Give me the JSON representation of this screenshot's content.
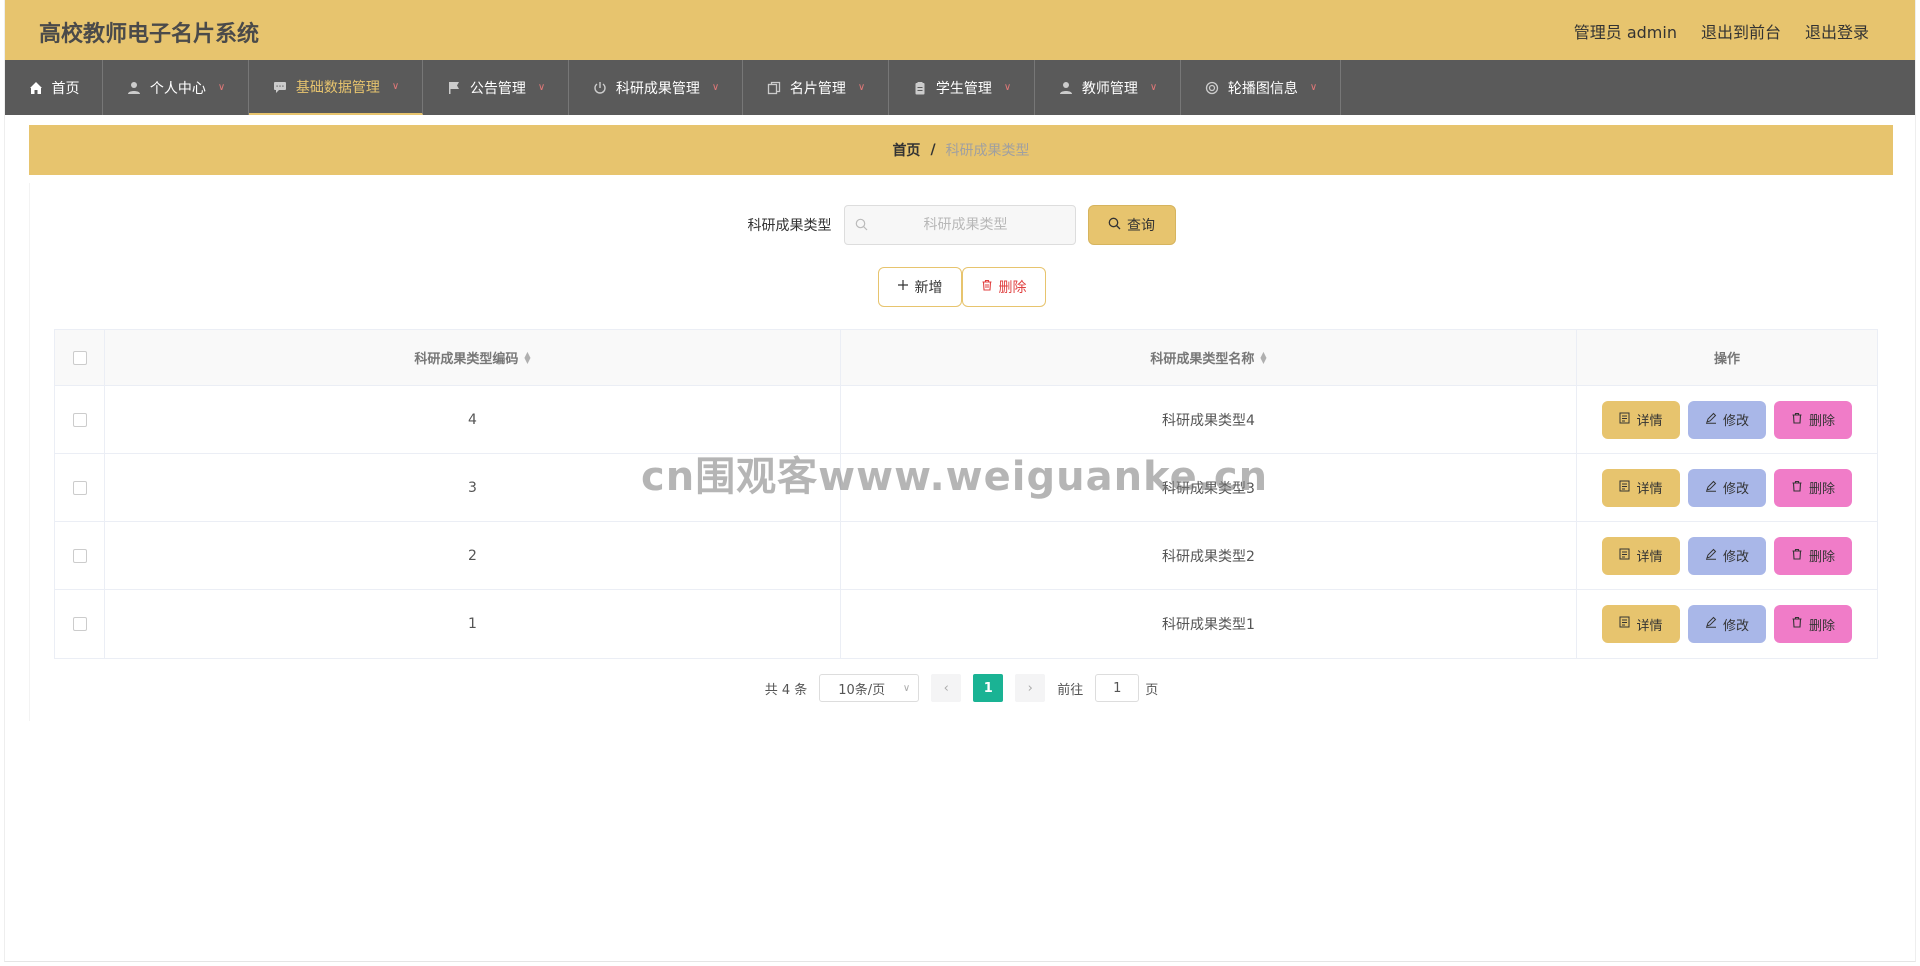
{
  "app": {
    "title": "高校教师电子名片系统",
    "admin_label": "管理员 admin",
    "to_front": "退出到前台",
    "logout": "退出登录"
  },
  "nav": [
    {
      "label": "首页",
      "icon": "home-icon",
      "has_dropdown": false,
      "active": false
    },
    {
      "label": "个人中心",
      "icon": "user-icon",
      "has_dropdown": true,
      "active": false
    },
    {
      "label": "基础数据管理",
      "icon": "chat-icon",
      "has_dropdown": true,
      "active": true
    },
    {
      "label": "公告管理",
      "icon": "flag-icon",
      "has_dropdown": true,
      "active": false
    },
    {
      "label": "科研成果管理",
      "icon": "power-icon",
      "has_dropdown": true,
      "active": false
    },
    {
      "label": "名片管理",
      "icon": "copy-icon",
      "has_dropdown": true,
      "active": false
    },
    {
      "label": "学生管理",
      "icon": "clipboard-icon",
      "has_dropdown": true,
      "active": false
    },
    {
      "label": "教师管理",
      "icon": "user-icon",
      "has_dropdown": true,
      "active": false
    },
    {
      "label": "轮播图信息",
      "icon": "circle-icon",
      "has_dropdown": true,
      "active": false
    }
  ],
  "breadcrumb": {
    "home": "首页",
    "separator": "/",
    "current": "科研成果类型"
  },
  "search": {
    "label": "科研成果类型",
    "placeholder": "科研成果类型",
    "value": "",
    "query_button": "查询"
  },
  "actions": {
    "add": "新增",
    "delete": "删除"
  },
  "table": {
    "columns": [
      "科研成果类型编码",
      "科研成果类型名称",
      "操作"
    ],
    "rows": [
      {
        "code": "4",
        "name": "科研成果类型4"
      },
      {
        "code": "3",
        "name": "科研成果类型3"
      },
      {
        "code": "2",
        "name": "科研成果类型2"
      },
      {
        "code": "1",
        "name": "科研成果类型1"
      }
    ],
    "op_detail": "详情",
    "op_edit": "修改",
    "op_delete": "删除"
  },
  "pagination": {
    "total_text": "共 4 条",
    "page_size": "10条/页",
    "current_page": "1",
    "goto_label": "前往",
    "goto_value": "1",
    "page_suffix": "页"
  },
  "watermark": "cn围观客www.weiguanke.cn",
  "colors": {
    "header": "#e7c46e",
    "nav": "#5a5a5a",
    "detail_btn": "#e7c46e",
    "edit_btn": "#a9b7e8",
    "delete_btn": "#f07cc8",
    "page_active": "#1ab394"
  }
}
